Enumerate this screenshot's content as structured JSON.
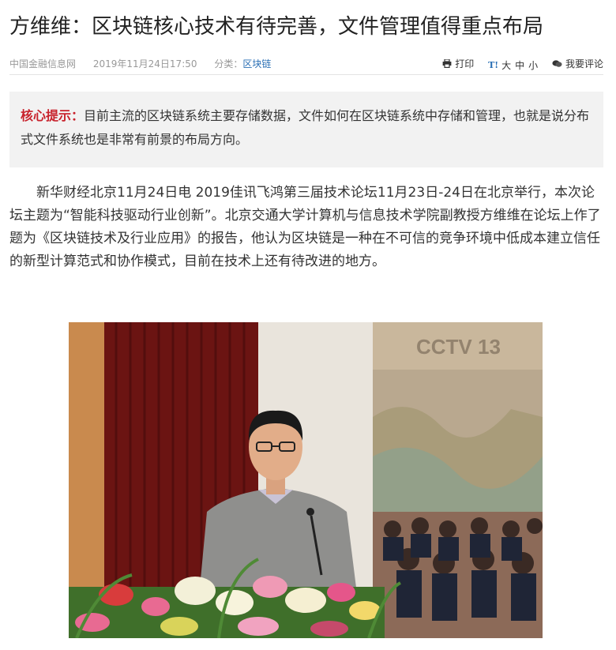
{
  "article": {
    "title": "方维维：区块链核心技术有待完善，文件管理值得重点布局",
    "source": "中国金融信息网",
    "datetime": "2019年11月24日17:50",
    "category_label": "分类：",
    "category": "区块链",
    "print_label": "打印",
    "size_icon": "T!",
    "size_large": "大",
    "size_medium": "中",
    "size_small": "小",
    "comment_label": "我要评论",
    "tip_label": "核心提示：",
    "tip_text": "目前主流的区块链系统主要存储数据，文件如何在区块链系统中存储和管理，也就是说分布式文件系统也是非常有前景的布局方向。",
    "body": "新华财经北京11月24日电  2019佳讯飞鸿第三届技术论坛11月23日-24日在北京举行，本次论坛主题为“智能科技驱动行业创新”。北京交通大学计算机与信息技术学院副教授方维维在论坛上作了题为《区块链技术及行业应用》的报告，他认为区块链是一种在不可信的竞争环境中低成本建立信任的新型计算范式和协作模式，目前在技术上还有待改进的地方。"
  },
  "icons": {
    "print": "printer-icon",
    "size": "text-size-icon",
    "comment": "chat-bubble-icon"
  },
  "colors": {
    "link": "#2a6fb5",
    "tip_label": "#c8222c",
    "tip_background": "#f2f2f2"
  },
  "photo": {
    "screen_text": "CCTV 13"
  }
}
